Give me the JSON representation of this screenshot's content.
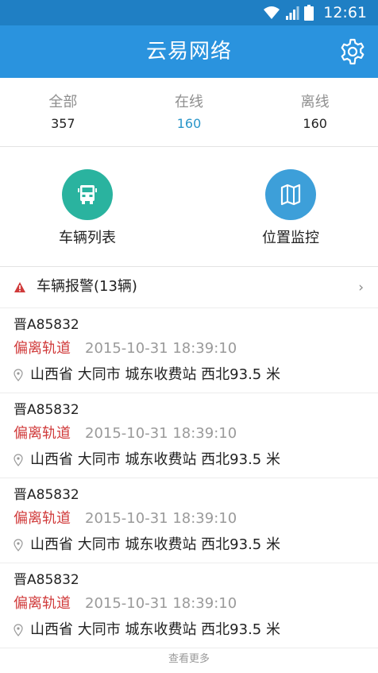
{
  "status_bar": {
    "time": "12:61"
  },
  "header": {
    "title": "云易网络",
    "settings_icon": "gear-icon"
  },
  "stats": [
    {
      "label": "全部",
      "value": "357"
    },
    {
      "label": "在线",
      "value": "160"
    },
    {
      "label": "离线",
      "value": "160"
    }
  ],
  "quick_actions": [
    {
      "label": "车辆列表",
      "icon": "truck-icon",
      "color": "#2ab39f"
    },
    {
      "label": "位置监控",
      "icon": "map-icon",
      "color": "#3d9fd9"
    }
  ],
  "alarms": {
    "title": "车辆报警(13辆)",
    "items": [
      {
        "plate": "晋A85832",
        "event": "偏离轨道",
        "time": "2015-10-31  18:39:10",
        "location": "山西省 大同市 城东收费站 西北93.5 米"
      },
      {
        "plate": "晋A85832",
        "event": "偏离轨道",
        "time": "2015-10-31  18:39:10",
        "location": "山西省 大同市 城东收费站 西北93.5 米"
      },
      {
        "plate": "晋A85832",
        "event": "偏离轨道",
        "time": "2015-10-31  18:39:10",
        "location": "山西省 大同市 城东收费站 西北93.5 米"
      },
      {
        "plate": "晋A85832",
        "event": "偏离轨道",
        "time": "2015-10-31  18:39:10",
        "location": "山西省 大同市 城东收费站 西北93.5 米"
      }
    ]
  },
  "footer": {
    "more_label": "查看更多"
  },
  "colors": {
    "header": "#2a93de",
    "status_bar": "#1f7fc4",
    "alert": "#d03a3a",
    "online": "#2a96c9"
  }
}
